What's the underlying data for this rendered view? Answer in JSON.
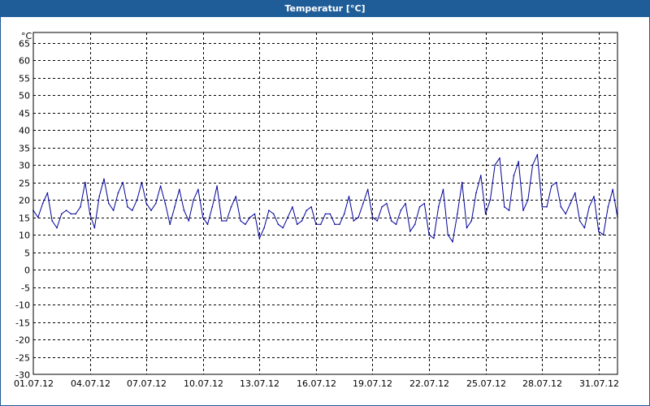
{
  "window": {
    "title": "Temperatur [°C]"
  },
  "colors": {
    "titlebar": "#1f5d98",
    "line": "#000099",
    "grid": "#000000",
    "background": "#ffffff"
  },
  "chart_data": {
    "type": "line",
    "title": "Temperatur [°C]",
    "unit_label": "°C",
    "xlabel": "",
    "ylabel": "",
    "ylim": [
      -30,
      68
    ],
    "yticks": [
      -30,
      -25,
      -20,
      -15,
      -10,
      -5,
      0,
      5,
      10,
      15,
      20,
      25,
      30,
      35,
      40,
      45,
      50,
      55,
      60,
      65
    ],
    "xlim": [
      "01.07.12",
      "01.08.12"
    ],
    "xtick_labels": [
      "01.07.12",
      "04.07.12",
      "07.07.12",
      "10.07.12",
      "13.07.12",
      "16.07.12",
      "19.07.12",
      "22.07.12",
      "25.07.12",
      "28.07.12",
      "31.07.12"
    ],
    "grid": true,
    "grid_style": "dashed",
    "legend": "none",
    "series": [
      {
        "color": "#000099",
        "x": [
          "01.07.12 00:00",
          "01.07.12 06:00",
          "01.07.12 12:00",
          "01.07.12 18:00",
          "02.07.12 00:00",
          "02.07.12 06:00",
          "02.07.12 12:00",
          "02.07.12 18:00",
          "03.07.12 00:00",
          "03.07.12 06:00",
          "03.07.12 12:00",
          "03.07.12 18:00",
          "04.07.12 00:00",
          "04.07.12 06:00",
          "04.07.12 12:00",
          "04.07.12 18:00",
          "05.07.12 00:00",
          "05.07.12 06:00",
          "05.07.12 12:00",
          "05.07.12 18:00",
          "06.07.12 00:00",
          "06.07.12 06:00",
          "06.07.12 12:00",
          "06.07.12 18:00",
          "07.07.12 00:00",
          "07.07.12 06:00",
          "07.07.12 12:00",
          "07.07.12 18:00",
          "08.07.12 00:00",
          "08.07.12 06:00",
          "08.07.12 12:00",
          "08.07.12 18:00",
          "09.07.12 00:00",
          "09.07.12 06:00",
          "09.07.12 12:00",
          "09.07.12 18:00",
          "10.07.12 00:00",
          "10.07.12 06:00",
          "10.07.12 12:00",
          "10.07.12 18:00",
          "11.07.12 00:00",
          "11.07.12 06:00",
          "11.07.12 12:00",
          "11.07.12 18:00",
          "12.07.12 00:00",
          "12.07.12 06:00",
          "12.07.12 12:00",
          "12.07.12 18:00",
          "13.07.12 00:00",
          "13.07.12 06:00",
          "13.07.12 12:00",
          "13.07.12 18:00",
          "14.07.12 00:00",
          "14.07.12 06:00",
          "14.07.12 12:00",
          "14.07.12 18:00",
          "15.07.12 00:00",
          "15.07.12 06:00",
          "15.07.12 12:00",
          "15.07.12 18:00",
          "16.07.12 00:00",
          "16.07.12 06:00",
          "16.07.12 12:00",
          "16.07.12 18:00",
          "17.07.12 00:00",
          "17.07.12 06:00",
          "17.07.12 12:00",
          "17.07.12 18:00",
          "18.07.12 00:00",
          "18.07.12 06:00",
          "18.07.12 12:00",
          "18.07.12 18:00",
          "19.07.12 00:00",
          "19.07.12 06:00",
          "19.07.12 12:00",
          "19.07.12 18:00",
          "20.07.12 00:00",
          "20.07.12 06:00",
          "20.07.12 12:00",
          "20.07.12 18:00",
          "21.07.12 00:00",
          "21.07.12 06:00",
          "21.07.12 12:00",
          "21.07.12 18:00",
          "22.07.12 00:00",
          "22.07.12 06:00",
          "22.07.12 12:00",
          "22.07.12 18:00",
          "23.07.12 00:00",
          "23.07.12 06:00",
          "23.07.12 12:00",
          "23.07.12 18:00",
          "24.07.12 00:00",
          "24.07.12 06:00",
          "24.07.12 12:00",
          "24.07.12 18:00",
          "25.07.12 00:00",
          "25.07.12 06:00",
          "25.07.12 12:00",
          "25.07.12 18:00",
          "26.07.12 00:00",
          "26.07.12 06:00",
          "26.07.12 12:00",
          "26.07.12 18:00",
          "27.07.12 00:00",
          "27.07.12 06:00",
          "27.07.12 12:00",
          "27.07.12 18:00",
          "28.07.12 00:00",
          "28.07.12 06:00",
          "28.07.12 12:00",
          "28.07.12 18:00",
          "29.07.12 00:00",
          "29.07.12 06:00",
          "29.07.12 12:00",
          "29.07.12 18:00",
          "30.07.12 00:00",
          "30.07.12 06:00",
          "30.07.12 12:00",
          "30.07.12 18:00",
          "31.07.12 00:00",
          "31.07.12 06:00",
          "31.07.12 12:00",
          "31.07.12 18:00",
          "01.08.12 00:00"
        ],
        "values": [
          17,
          15,
          19,
          22,
          14,
          12,
          16,
          17,
          16,
          16,
          18,
          25,
          16,
          12,
          21,
          26,
          19,
          17,
          22,
          25,
          18,
          17,
          20,
          25,
          19,
          17,
          19,
          24,
          19,
          13,
          18,
          23,
          17,
          14,
          20,
          23,
          15,
          13,
          18,
          24,
          14,
          14,
          18,
          21,
          14,
          13,
          15,
          16,
          9,
          12,
          17,
          16,
          13,
          12,
          15,
          18,
          13,
          14,
          17,
          18,
          13,
          13,
          16,
          16,
          13,
          13,
          16,
          21,
          14,
          15,
          19,
          23,
          15,
          14,
          18,
          19,
          14,
          13,
          17,
          19,
          11,
          13,
          18,
          19,
          10,
          9,
          18,
          23,
          10,
          8,
          16,
          25,
          12,
          14,
          22,
          27,
          16,
          20,
          30,
          32,
          18,
          17,
          27,
          31,
          17,
          20,
          30,
          33,
          18,
          18,
          24,
          25,
          18,
          16,
          19,
          22,
          14,
          12,
          18,
          21,
          11,
          10,
          18,
          23,
          15
        ]
      }
    ]
  }
}
